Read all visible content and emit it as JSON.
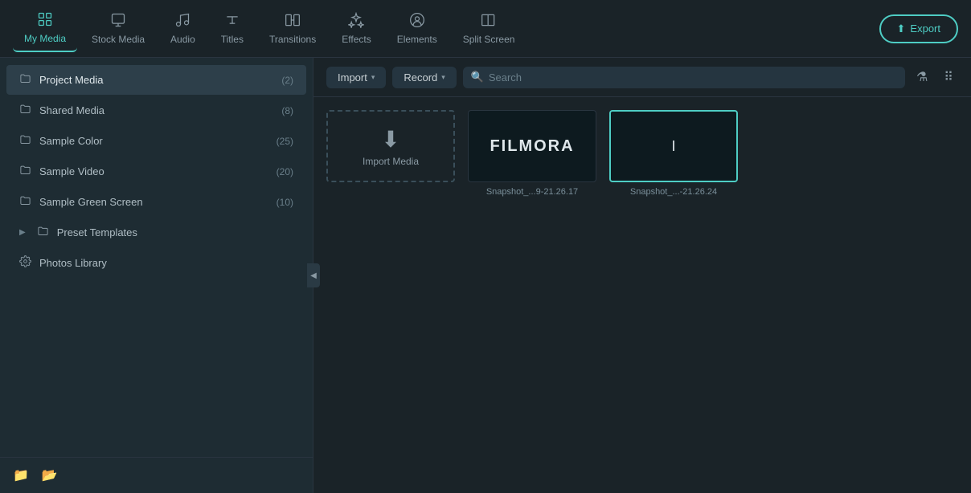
{
  "nav": {
    "items": [
      {
        "id": "my-media",
        "label": "My Media",
        "icon": "🖼",
        "active": true
      },
      {
        "id": "stock-media",
        "label": "Stock Media",
        "icon": "📷",
        "active": false
      },
      {
        "id": "audio",
        "label": "Audio",
        "icon": "♪",
        "active": false
      },
      {
        "id": "titles",
        "label": "Titles",
        "icon": "T",
        "active": false
      },
      {
        "id": "transitions",
        "label": "Transitions",
        "icon": "⊠",
        "active": false
      },
      {
        "id": "effects",
        "label": "Effects",
        "icon": "✦",
        "active": false
      },
      {
        "id": "elements",
        "label": "Elements",
        "icon": "☺",
        "active": false
      },
      {
        "id": "split-screen",
        "label": "Split Screen",
        "icon": "▦",
        "active": false
      }
    ],
    "export_label": "Export"
  },
  "sidebar": {
    "items": [
      {
        "id": "project-media",
        "label": "Project Media",
        "count": "(2)",
        "active": true,
        "has_chevron": false
      },
      {
        "id": "shared-media",
        "label": "Shared Media",
        "count": "(8)",
        "active": false,
        "has_chevron": false
      },
      {
        "id": "sample-color",
        "label": "Sample Color",
        "count": "(25)",
        "active": false,
        "has_chevron": false
      },
      {
        "id": "sample-video",
        "label": "Sample Video",
        "count": "(20)",
        "active": false,
        "has_chevron": false
      },
      {
        "id": "sample-green-screen",
        "label": "Sample Green Screen",
        "count": "(10)",
        "active": false,
        "has_chevron": false
      },
      {
        "id": "preset-templates",
        "label": "Preset Templates",
        "count": "",
        "active": false,
        "has_chevron": true
      },
      {
        "id": "photos-library",
        "label": "Photos Library",
        "count": "",
        "active": false,
        "has_chevron": false,
        "is_gear": true
      }
    ],
    "footer_icons": [
      "new-folder",
      "import-folder"
    ]
  },
  "toolbar": {
    "import_label": "Import",
    "record_label": "Record",
    "search_placeholder": "Search"
  },
  "media": {
    "items": [
      {
        "id": "import-media",
        "type": "import",
        "label": "Import Media"
      },
      {
        "id": "snapshot1",
        "type": "snapshot",
        "text": "FILMORA",
        "filename": "Snapshot_...9-21.26.17"
      },
      {
        "id": "snapshot2",
        "type": "snapshot2",
        "text": "I",
        "filename": "Snapshot_...-21.26.24"
      }
    ]
  }
}
